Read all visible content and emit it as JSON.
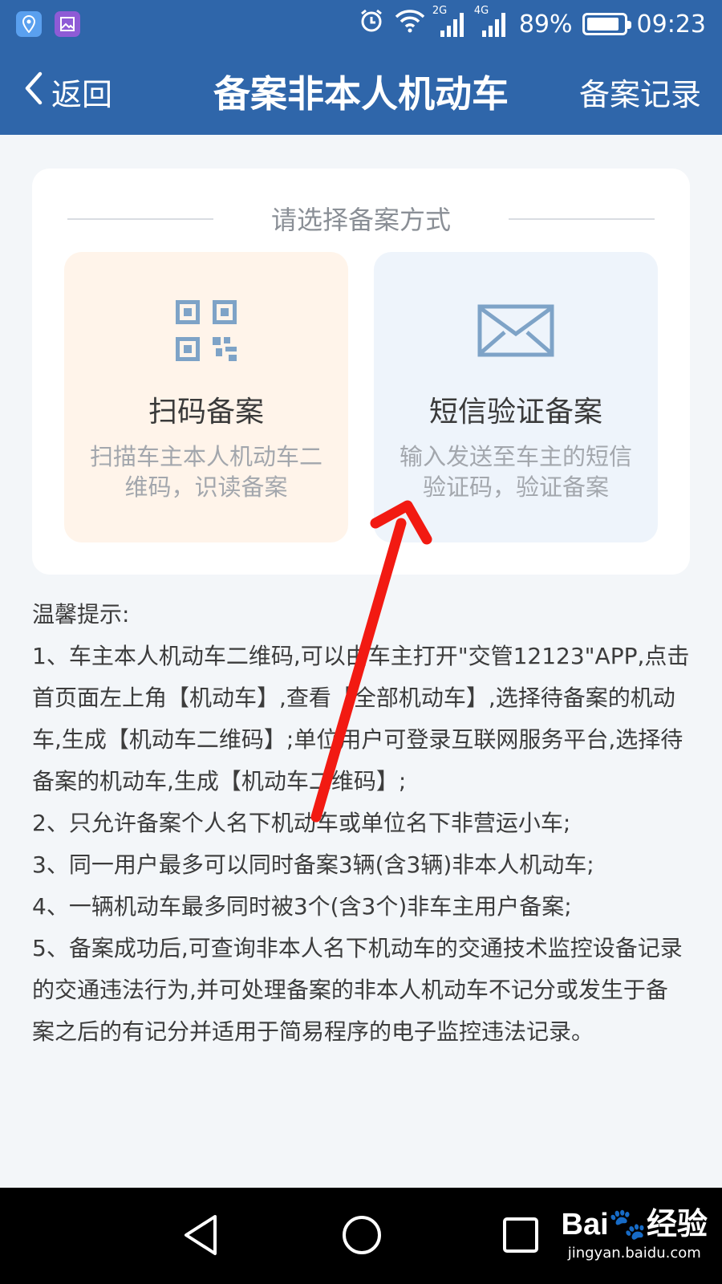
{
  "status_bar": {
    "network_2g": "2G",
    "network_4g": "4G",
    "battery_text": "89%",
    "battery_level": 0.89,
    "time": "09:23",
    "icons": [
      "location-app-icon",
      "gallery-app-icon",
      "alarm-icon",
      "wifi-icon",
      "signal-icon",
      "battery-icon"
    ]
  },
  "nav": {
    "back_label": "返回",
    "title": "备案非本人机动车",
    "records_label": "备案记录"
  },
  "card": {
    "heading": "请选择备案方式",
    "options": [
      {
        "title": "扫码备案",
        "desc_line1": "扫描车主本人机动车二",
        "desc_line2": "维码，识读备案",
        "icon": "qr-code-icon"
      },
      {
        "title": "短信验证备案",
        "desc_line1": "输入发送至车主的短信",
        "desc_line2": "验证码，验证备案",
        "icon": "envelope-icon"
      }
    ]
  },
  "tips": {
    "heading": "温馨提示:",
    "items": [
      "1、车主本人机动车二维码,可以由车主打开\"交管12123\"APP,点击首页面左上角【机动车】,查看【全部机动车】,选择待备案的机动车,生成【机动车二维码】;单位用户可登录互联网服务平台,选择待备案的机动车,生成【机动车二维码】;",
      "2、只允许备案个人名下机动车或单位名下非营运小车;",
      "3、同一用户最多可以同时备案3辆(含3辆)非本人机动车;",
      "4、一辆机动车最多同时被3个(含3个)非车主用户备案;",
      "5、备案成功后,可查询非本人名下机动车的交通技术监控设备记录的交通违法行为,并可处理备案的非本人机动车不记分或发生于备案之后的有记分并适用于简易程序的电子监控违法记录。"
    ]
  },
  "watermark": {
    "logo_text": "Bai",
    "logo_suffix": "经验",
    "url": "jingyan.baidu.com"
  },
  "colors": {
    "header_blue": "#2f66aa",
    "scan_bg": "#fff4ea",
    "sms_bg": "#eef4fb",
    "icon_blue": "#7ea3c7",
    "annotation_red": "#f21a12"
  }
}
